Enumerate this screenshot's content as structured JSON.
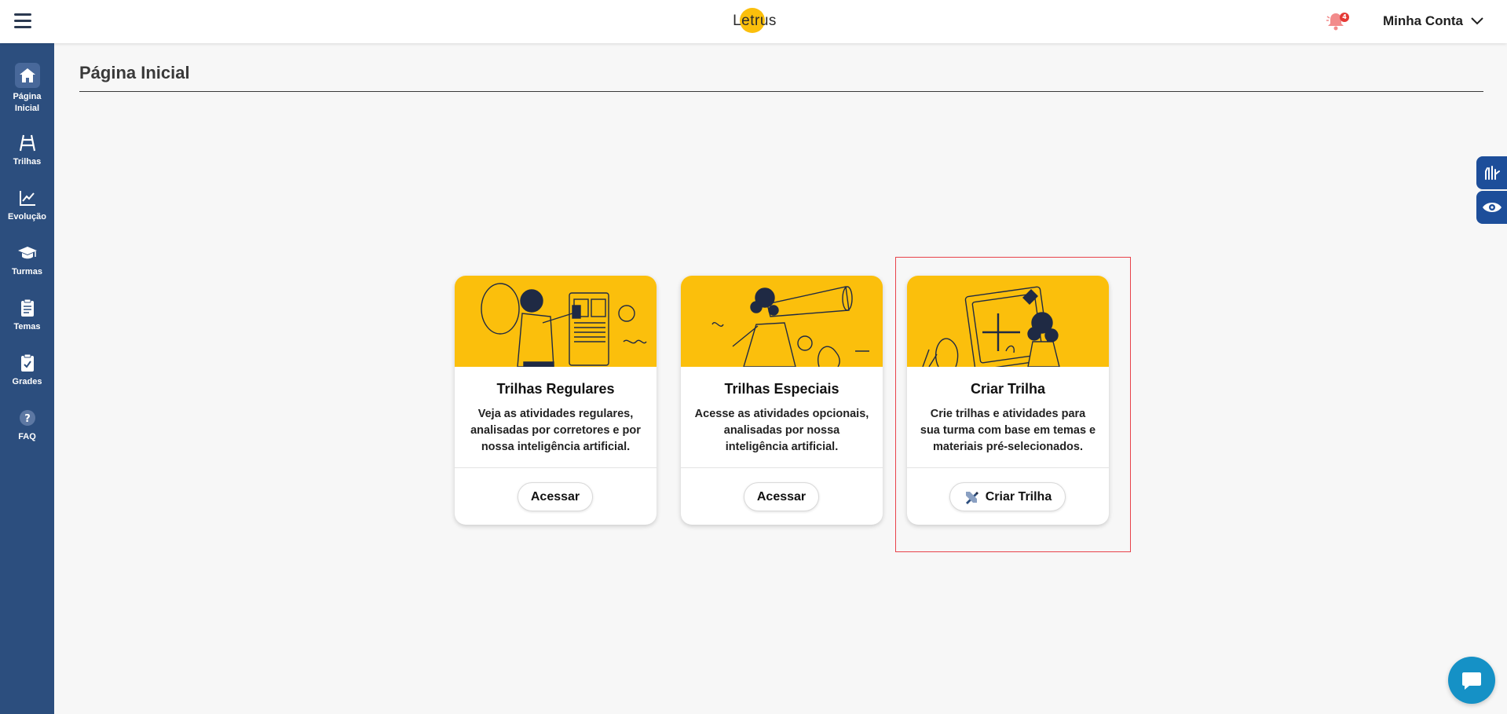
{
  "header": {
    "logo_text": "Letrus",
    "notification_count": "4",
    "account_label": "Minha Conta"
  },
  "sidebar": {
    "items": [
      {
        "label_line1": "Página",
        "label_line2": "Inicial",
        "icon": "home-icon"
      },
      {
        "label": "Trilhas",
        "icon": "trail-icon"
      },
      {
        "label": "Evolução",
        "icon": "chart-icon"
      },
      {
        "label": "Turmas",
        "icon": "graduation-cap-icon"
      },
      {
        "label": "Temas",
        "icon": "clipboard-icon"
      },
      {
        "label": "Grades",
        "icon": "clipboard-check-icon"
      },
      {
        "label": "FAQ",
        "icon": "question-icon"
      }
    ]
  },
  "page": {
    "title": "Página Inicial"
  },
  "cards": [
    {
      "title": "Trilhas Regulares",
      "description": "Veja as atividades regulares, analisadas por corretores e por nossa inteligência artificial.",
      "button": "Acessar"
    },
    {
      "title": "Trilhas Especiais",
      "description": "Acesse as atividades opcionais, analisadas por nossa inteligência artificial.",
      "button": "Acessar"
    },
    {
      "title": "Criar Trilha",
      "description": "Crie trilhas e atividades para sua turma com base em temas e materiais pré-selecionados.",
      "button": "Criar Trilha"
    }
  ],
  "colors": {
    "sidebar": "#2c4e7e",
    "accent_yellow": "#fbbf0c",
    "highlight_border": "#e8424a",
    "a11y_blue": "#1d4e9a",
    "chat_blue": "#1591c6"
  }
}
